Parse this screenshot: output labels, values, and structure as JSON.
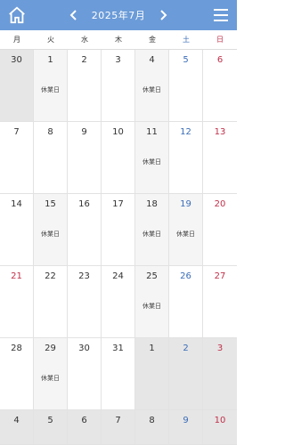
{
  "header": {
    "title": "2025年7月",
    "home_icon": "home-icon",
    "menu_icon": "hamburger-menu-icon",
    "prev_icon": "chevron-left-icon",
    "next_icon": "chevron-right-icon",
    "bg_color": "#6b9bd8"
  },
  "weekdays": [
    {
      "label": "月",
      "kind": "weekday"
    },
    {
      "label": "火",
      "kind": "weekday"
    },
    {
      "label": "水",
      "kind": "weekday"
    },
    {
      "label": "木",
      "kind": "weekday"
    },
    {
      "label": "金",
      "kind": "weekday"
    },
    {
      "label": "土",
      "kind": "sat"
    },
    {
      "label": "日",
      "kind": "sun"
    }
  ],
  "weeks": [
    [
      {
        "day": "30",
        "other": true,
        "holiday": false,
        "note": ""
      },
      {
        "day": "1",
        "other": false,
        "holiday": true,
        "note": "休業日"
      },
      {
        "day": "2",
        "other": false,
        "holiday": false,
        "note": ""
      },
      {
        "day": "3",
        "other": false,
        "holiday": false,
        "note": ""
      },
      {
        "day": "4",
        "other": false,
        "holiday": true,
        "note": "休業日"
      },
      {
        "day": "5",
        "other": false,
        "holiday": false,
        "note": ""
      },
      {
        "day": "6",
        "other": false,
        "holiday": false,
        "note": ""
      }
    ],
    [
      {
        "day": "7",
        "other": false,
        "holiday": false,
        "note": ""
      },
      {
        "day": "8",
        "other": false,
        "holiday": false,
        "note": ""
      },
      {
        "day": "9",
        "other": false,
        "holiday": false,
        "note": ""
      },
      {
        "day": "10",
        "other": false,
        "holiday": false,
        "note": ""
      },
      {
        "day": "11",
        "other": false,
        "holiday": true,
        "note": "休業日"
      },
      {
        "day": "12",
        "other": false,
        "holiday": false,
        "note": ""
      },
      {
        "day": "13",
        "other": false,
        "holiday": false,
        "note": ""
      }
    ],
    [
      {
        "day": "14",
        "other": false,
        "holiday": false,
        "note": ""
      },
      {
        "day": "15",
        "other": false,
        "holiday": true,
        "note": "休業日"
      },
      {
        "day": "16",
        "other": false,
        "holiday": false,
        "note": ""
      },
      {
        "day": "17",
        "other": false,
        "holiday": false,
        "note": ""
      },
      {
        "day": "18",
        "other": false,
        "holiday": true,
        "note": "休業日"
      },
      {
        "day": "19",
        "other": false,
        "holiday": true,
        "note": "休業日"
      },
      {
        "day": "20",
        "other": false,
        "holiday": false,
        "note": ""
      }
    ],
    [
      {
        "day": "21",
        "other": false,
        "holiday": false,
        "note": "",
        "sun": true
      },
      {
        "day": "22",
        "other": false,
        "holiday": false,
        "note": ""
      },
      {
        "day": "23",
        "other": false,
        "holiday": false,
        "note": ""
      },
      {
        "day": "24",
        "other": false,
        "holiday": false,
        "note": ""
      },
      {
        "day": "25",
        "other": false,
        "holiday": true,
        "note": "休業日"
      },
      {
        "day": "26",
        "other": false,
        "holiday": false,
        "note": ""
      },
      {
        "day": "27",
        "other": false,
        "holiday": false,
        "note": ""
      }
    ],
    [
      {
        "day": "28",
        "other": false,
        "holiday": false,
        "note": ""
      },
      {
        "day": "29",
        "other": false,
        "holiday": true,
        "note": "休業日"
      },
      {
        "day": "30",
        "other": false,
        "holiday": false,
        "note": ""
      },
      {
        "day": "31",
        "other": false,
        "holiday": false,
        "note": ""
      },
      {
        "day": "1",
        "other": true,
        "holiday": false,
        "note": ""
      },
      {
        "day": "2",
        "other": true,
        "holiday": false,
        "note": ""
      },
      {
        "day": "3",
        "other": true,
        "holiday": false,
        "note": ""
      }
    ],
    [
      {
        "day": "4",
        "other": true,
        "holiday": false,
        "note": ""
      },
      {
        "day": "5",
        "other": true,
        "holiday": false,
        "note": ""
      },
      {
        "day": "6",
        "other": true,
        "holiday": false,
        "note": ""
      },
      {
        "day": "7",
        "other": true,
        "holiday": false,
        "note": ""
      },
      {
        "day": "8",
        "other": true,
        "holiday": false,
        "note": ""
      },
      {
        "day": "9",
        "other": true,
        "holiday": false,
        "note": ""
      },
      {
        "day": "10",
        "other": true,
        "holiday": false,
        "note": ""
      }
    ]
  ],
  "colors": {
    "saturday": "#3a6db8",
    "sunday": "#c0304a",
    "holiday_bg": "#f5f5f5",
    "other_month_bg": "#e6e6e6"
  }
}
